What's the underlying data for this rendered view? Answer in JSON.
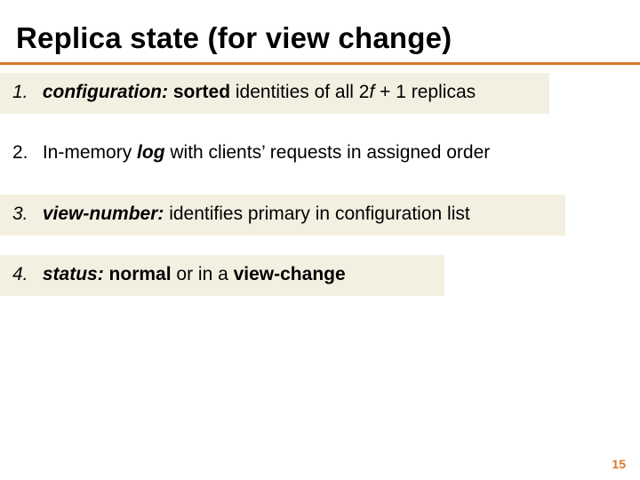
{
  "title": "Replica state (for view change)",
  "items": [
    {
      "num": "1.",
      "term": "configuration:",
      "rest_pre_bold": " ",
      "bold_after_term": "sorted",
      "rest_mid": " identities of all 2",
      "f": "f",
      "rest_tail": " + 1 replicas"
    },
    {
      "num": "2.",
      "plain_pre": "In-memory ",
      "term_noital_prefix": "",
      "log": "log",
      "plain_post": " with clients’ requests in assigned order"
    },
    {
      "num": "3.",
      "term": "view-number:",
      "rest": " identifies primary in configuration list"
    },
    {
      "num": "4.",
      "term": "status:",
      "rest_pre_bold": " ",
      "bold1": "normal",
      "mid": " or in a ",
      "bold2": "view-change"
    }
  ],
  "page_number": "15"
}
